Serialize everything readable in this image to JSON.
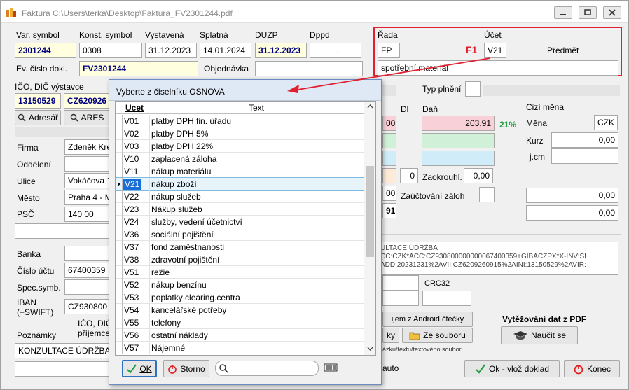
{
  "window": {
    "title": "Faktura C:\\Users\\terka\\Desktop\\Faktura_FV2301244.pdf"
  },
  "header": {
    "var_symbol_label": "Var. symbol",
    "var_symbol": "2301244",
    "konst_symbol_label": "Konst. symbol",
    "konst_symbol": "0308",
    "vystavena_label": "Vystavená",
    "vystavena": "31.12.2023",
    "splatna_label": "Splatná",
    "splatna": "14.01.2024",
    "duzp_label": "DUZP",
    "duzp": "31.12.2023",
    "dppd_label": "Dppd",
    "dppd": ". .",
    "ev_cislo_label": "Ev. číslo dokl.",
    "ev_cislo": "FV2301244",
    "objednavka_label": "Objednávka",
    "objednavka": ""
  },
  "rada_box": {
    "rada_label": "Řada",
    "rada": "FP",
    "ucet_label": "Účet",
    "ucet": "V21",
    "predmet_label": "Předmět",
    "f1_label": "F1",
    "predmet": "spotřební materiál"
  },
  "supplier": {
    "ico_dic_label": "IČO, DIČ výstavce",
    "ico": "13150529",
    "dic": "CZ620926",
    "adresar_btn": "Adresář",
    "ares_btn": "ARES",
    "firma_label": "Firma",
    "firma": "Zdeněk Kre",
    "oddeleni_label": "Oddělení",
    "ulice_label": "Ulice",
    "ulice": "Vokáčova 1",
    "mesto_label": "Město",
    "mesto": "Praha 4 - M",
    "psc_label": "PSČ",
    "psc": "140 00",
    "banka_label": "Banka",
    "cislo_uctu_label": "Číslo účtu",
    "cislo_uctu": "67400359",
    "spec_symb_label": "Spec.symb.",
    "iban_label": "IBAN\n(+SWIFT)",
    "iban": "CZ930800",
    "poznamky_label": "Poznámky",
    "ico_dic_prijemce": "IČO, DIČ\npříjemce",
    "poznamky": "KONZULTACE ÚDRŽBA"
  },
  "right_panel": {
    "typ_plneni_label": "Typ plnění",
    "dl_label": "Dl",
    "dan_label": "Daň",
    "dan_value": "203,91",
    "dan_pct": "21%",
    "left_val_1": "00",
    "zaokrouhl_label": "Zaokrouhl.",
    "zaokrouhl_value": "0,00",
    "dl_value": "0",
    "zauctovani_label": "Zaúčtování záloh",
    "left_val_2": "00",
    "left_val_3": "91",
    "cizi_mena_label": "Cizí měna",
    "mena_label": "Měna",
    "mena": "CZK",
    "kurz_label": "Kurz",
    "kurz": "0,00",
    "jcm_label": "j.cm",
    "total_1": "0,00",
    "total_2": "0,00",
    "qr_text_1": "ULTACE ÚDRŽBA",
    "qr_text_2": "CC:CZK*ACC:CZ930800000000067400359+GIBACZPX*X-INV:SI",
    "qr_text_3": "ADD:20231231%2AVII:CZ6209260915%2AINI:13150529%2AVIR:",
    "crc32_label": "CRC32",
    "android_btn": "ijem z Android čtečky",
    "ky_btn": "ky",
    "ze_souboru_btn": "Ze souboru",
    "soubor_note": "ázku/textu/textového souboru",
    "vytezovani_label": "Vytěžování dat z PDF",
    "naucit_btn": "Naučit se",
    "auto_label": "auto",
    "ok_vloz_btn": "Ok - vlož doklad",
    "konec_btn": "Konec"
  },
  "dialog": {
    "title": "Vyberte z číselníku OSNOVA",
    "col_ucet": "Ucet",
    "col_text": "Text",
    "ok_btn": "OK",
    "storno_btn": "Storno",
    "search_value": "",
    "rows": [
      {
        "k": "V01",
        "v": "platby DPH fin. úřadu"
      },
      {
        "k": "V02",
        "v": "platby DPH  5%"
      },
      {
        "k": "V03",
        "v": "platby DPH 22%"
      },
      {
        "k": "V10",
        "v": "zaplacená záloha"
      },
      {
        "k": "V11",
        "v": "nákup materiálu"
      },
      {
        "k": "V21",
        "v": "nákup zboží"
      },
      {
        "k": "V22",
        "v": "nákup služeb"
      },
      {
        "k": "V23",
        "v": "Nákup služeb"
      },
      {
        "k": "V24",
        "v": "služby, vedení účetnictví"
      },
      {
        "k": "V36",
        "v": "sociální pojištění"
      },
      {
        "k": "V37",
        "v": "fond zaměstnanosti"
      },
      {
        "k": "V38",
        "v": "zdravotní pojištění"
      },
      {
        "k": "V51",
        "v": "režie"
      },
      {
        "k": "V52",
        "v": "nákup benzínu"
      },
      {
        "k": "V53",
        "v": "poplatky clearing.centra"
      },
      {
        "k": "V54",
        "v": "kancelářské potřeby"
      },
      {
        "k": "V55",
        "v": "telefony"
      },
      {
        "k": "V56",
        "v": "ostatní náklady"
      },
      {
        "k": "V57",
        "v": "Nájemné"
      }
    ],
    "selected_index": 5
  },
  "colors": {
    "accent_red": "#e02030",
    "selection_blue": "#1a6fd6",
    "pink": "#f8d0d8",
    "green": "#d0f0d8",
    "light_blue": "#d0ecf8",
    "yellow": "#ffffe0"
  }
}
